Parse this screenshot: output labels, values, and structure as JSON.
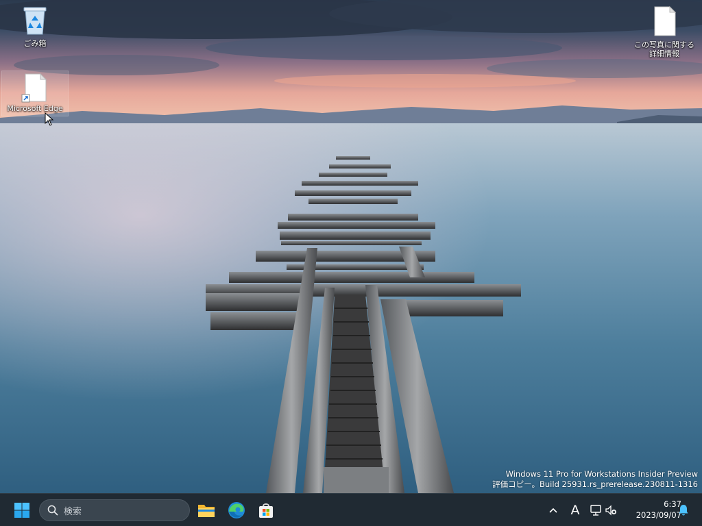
{
  "desktop": {
    "icons": [
      {
        "label": "ごみ箱",
        "icon": "recycle-bin-icon"
      },
      {
        "label": "Microsoft Edge",
        "icon": "shortcut-file-icon"
      },
      {
        "label": "この写真に関する詳細情報",
        "icon": "file-icon"
      }
    ],
    "watermark": {
      "line1": "Windows 11 Pro for Workstations Insider Preview",
      "line2": "評価コピー。Build 25931.rs_prerelease.230811-1316"
    }
  },
  "taskbar": {
    "start_icon": "windows-logo-icon",
    "search_placeholder": "検索",
    "apps": [
      {
        "icon": "file-explorer-icon"
      },
      {
        "icon": "edge-icon"
      },
      {
        "icon": "microsoft-store-icon"
      }
    ],
    "tray": {
      "ime_label": "A",
      "time": "6:37",
      "date": "2023/09/07"
    }
  },
  "colors": {
    "taskbar_bg": "#202a33",
    "accent_blue": "#0078d4",
    "search_bg": "#3a454f"
  }
}
